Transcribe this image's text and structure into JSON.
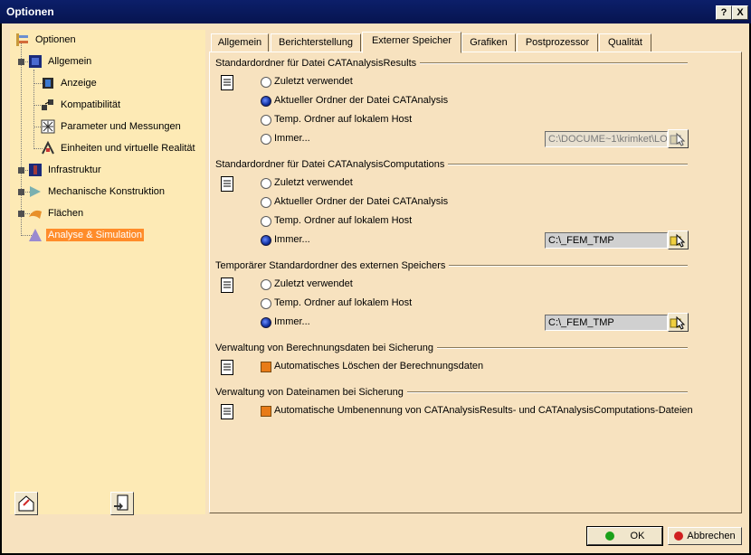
{
  "window": {
    "title": "Optionen",
    "help_label": "?",
    "close_label": "X"
  },
  "tree": {
    "items": [
      {
        "label": "Optionen",
        "icon": "options-tree-icon"
      },
      {
        "label": "Allgemein",
        "icon": "general-icon"
      },
      {
        "label": "Anzeige",
        "icon": "display-icon"
      },
      {
        "label": "Kompatibilität",
        "icon": "compatibility-icon"
      },
      {
        "label": "Parameter und Messungen",
        "icon": "parameters-icon"
      },
      {
        "label": "Einheiten und virtuelle Realität",
        "icon": "units-icon"
      },
      {
        "label": "Infrastruktur",
        "icon": "infrastructure-icon"
      },
      {
        "label": "Mechanische Konstruktion",
        "icon": "mechanical-design-icon"
      },
      {
        "label": "Flächen",
        "icon": "shape-icon"
      },
      {
        "label": "Analyse & Simulation",
        "icon": "analysis-icon",
        "selected": true
      }
    ]
  },
  "tabs": [
    {
      "label": "Allgemein"
    },
    {
      "label": "Berichterstellung"
    },
    {
      "label": "Externer Speicher",
      "active": true
    },
    {
      "label": "Grafiken"
    },
    {
      "label": "Postprozessor"
    },
    {
      "label": "Qualität"
    }
  ],
  "groups": {
    "results": {
      "title": "Standardordner für Datei CATAnalysisResults",
      "options": [
        "Zuletzt verwendet",
        "Aktueller Ordner der Datei CATAnalysis",
        "Temp. Ordner auf lokalem Host",
        "Immer..."
      ],
      "selected_index": 1,
      "path_value": "C:\\DOCUME~1\\krimket\\LO"
    },
    "computations": {
      "title": "Standardordner für Datei CATAnalysisComputations",
      "options": [
        "Zuletzt verwendet",
        "Aktueller Ordner der Datei CATAnalysis",
        "Temp. Ordner auf lokalem Host",
        "Immer..."
      ],
      "selected_index": 3,
      "path_value": "C:\\_FEM_TMP"
    },
    "temporary": {
      "title": "Temporärer Standardordner des externen Speichers",
      "options": [
        "Zuletzt verwendet",
        "Temp. Ordner auf lokalem Host",
        "Immer..."
      ],
      "selected_index": 2,
      "path_value": "C:\\_FEM_TMP"
    },
    "save_data": {
      "title": "Verwaltung von Berechnungsdaten bei Sicherung",
      "checkbox_label": "Automatisches Löschen der Berechnungsdaten"
    },
    "save_names": {
      "title": "Verwaltung von Dateinamen bei Sicherung",
      "checkbox_label": "Automatische Umbenennung von CATAnalysisResults- und CATAnalysisComputations-Dateien"
    }
  },
  "buttons": {
    "ok": "OK",
    "cancel": "Abbrechen"
  },
  "colors": {
    "panel": "#f7e2bf",
    "tree_bg": "#fdeab5",
    "selection": "#ff8c2a",
    "titlebar": "#0c1f6a"
  }
}
